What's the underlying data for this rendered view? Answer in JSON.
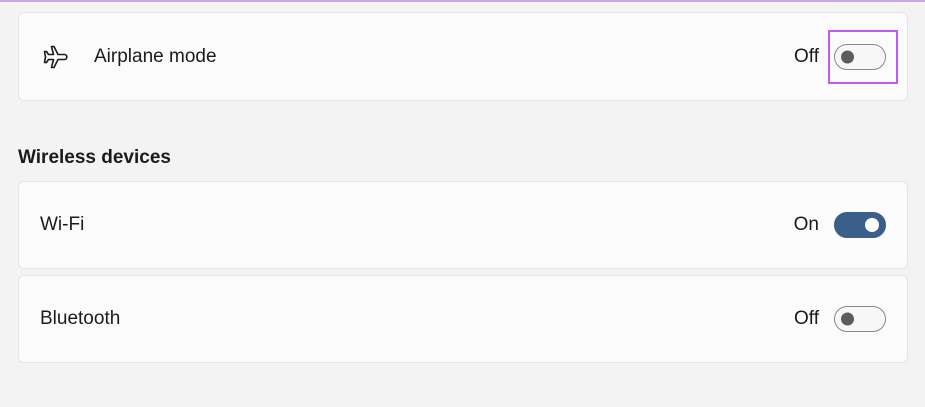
{
  "airplane_mode": {
    "label": "Airplane mode",
    "state_text": "Off",
    "toggle_on": false,
    "icon": "airplane-icon"
  },
  "wireless_devices": {
    "heading": "Wireless devices",
    "wifi": {
      "label": "Wi-Fi",
      "state_text": "On",
      "toggle_on": true
    },
    "bluetooth": {
      "label": "Bluetooth",
      "state_text": "Off",
      "toggle_on": false
    }
  },
  "colors": {
    "toggle_on": "#3a5f8a",
    "highlight": "#c05df0",
    "top_accent": "#c8a7e6",
    "page_background": "#f3f3f3",
    "card_background": "#fbfbfb"
  }
}
